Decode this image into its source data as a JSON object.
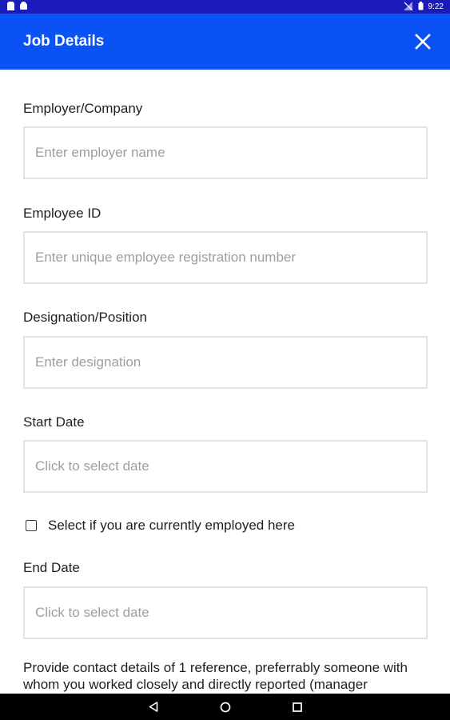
{
  "status_bar": {
    "time": "9:22",
    "left_icons": [
      "sim-card-icon",
      "android-icon"
    ],
    "right_icons": [
      "no-signal-icon",
      "battery-icon"
    ]
  },
  "app_bar": {
    "title": "Job Details",
    "close_icon": "close-icon",
    "background": "#0a52f4"
  },
  "form": {
    "employer": {
      "label": "Employer/Company",
      "placeholder": "Enter employer name",
      "value": ""
    },
    "employee_id": {
      "label": "Employee ID",
      "placeholder": "Enter unique employee registration number",
      "value": ""
    },
    "designation": {
      "label": "Designation/Position",
      "placeholder": "Enter designation",
      "value": ""
    },
    "start_date": {
      "label": "Start Date",
      "placeholder": "Click to select date",
      "value": ""
    },
    "currently_employed": {
      "label": "Select if you are currently employed here",
      "checked": false
    },
    "end_date": {
      "label": "End Date",
      "placeholder": "Click to select date",
      "value": ""
    },
    "reference_info": "Provide contact details of 1 reference, preferrably someone with whom you worked closely and directly reported (manager"
  },
  "nav_bar": {
    "buttons": [
      "back-icon",
      "home-icon",
      "recents-icon"
    ]
  }
}
